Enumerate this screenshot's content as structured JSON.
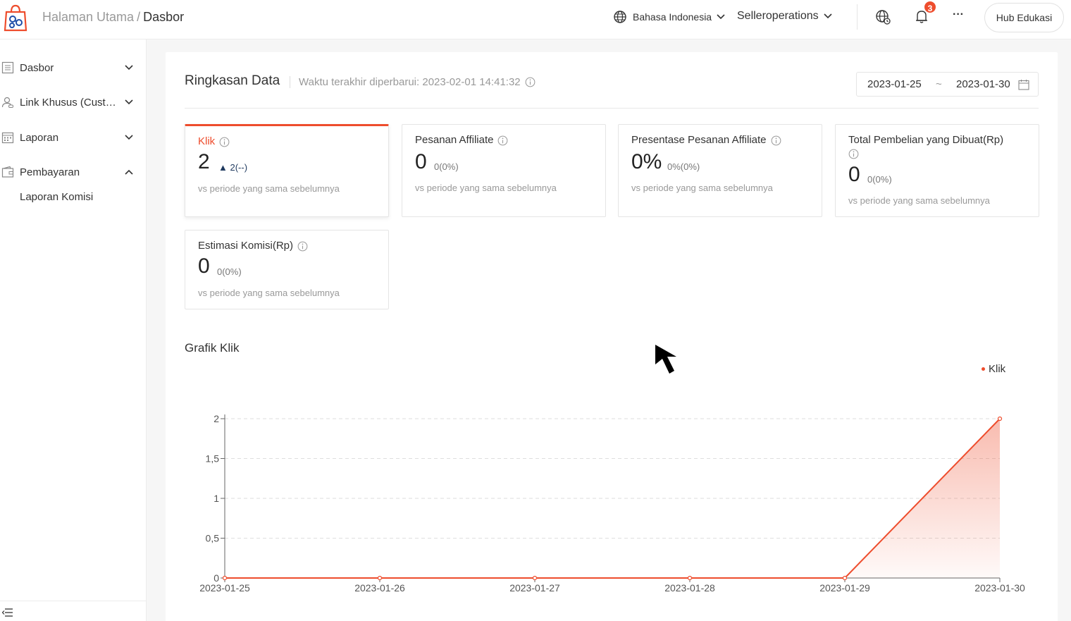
{
  "header": {
    "breadcrumb_home": "Halaman Utama",
    "breadcrumb_sep": "/",
    "breadcrumb_current": "Dasbor",
    "language": "Bahasa Indonesia",
    "shop_name": "Selleroperations",
    "notification_count": "3",
    "more_label": "···",
    "hub_button": "Hub Edukasi"
  },
  "sidebar": {
    "items": [
      {
        "label": "Dasbor",
        "icon": "list-icon"
      },
      {
        "label": "Link Khusus (Custom Link)",
        "icon": "user-link-icon"
      },
      {
        "label": "Laporan",
        "icon": "calendar-grid-icon"
      },
      {
        "label": "Pembayaran",
        "icon": "wallet-icon"
      }
    ],
    "subitems": [
      "Laporan Komisi"
    ]
  },
  "summary": {
    "title": "Ringkasan Data",
    "updated_label": "Waktu terakhir diperbarui: 2023-02-01 14:41:32",
    "date_start": "2023-01-25",
    "date_sep": "~",
    "date_end": "2023-01-30"
  },
  "metrics": [
    {
      "title": "Klik",
      "value": "2",
      "delta": "▲ 2(--)",
      "vs": "vs periode yang sama sebelumnya"
    },
    {
      "title": "Pesanan Affiliate",
      "value": "0",
      "delta": "0(0%)",
      "vs": "vs periode yang sama sebelumnya"
    },
    {
      "title": "Presentase Pesanan Affiliate",
      "value": "0%",
      "delta": "0%(0%)",
      "vs": "vs periode yang sama sebelumnya"
    },
    {
      "title": "Total Pembelian yang Dibuat(Rp)",
      "value": "0",
      "delta": "0(0%)",
      "vs": "vs periode yang sama sebelumnya"
    },
    {
      "title": "Estimasi Komisi(Rp)",
      "value": "0",
      "delta": "0(0%)",
      "vs": "vs periode yang sama sebelumnya"
    }
  ],
  "colors": {
    "accent": "#ee4d2d",
    "fill": "#f6c3b5"
  },
  "chart_section_title": "Grafik Klik",
  "chart_data": {
    "type": "area",
    "title": "Grafik Klik",
    "x": [
      "2023-01-25",
      "2023-01-26",
      "2023-01-27",
      "2023-01-28",
      "2023-01-29",
      "2023-01-30"
    ],
    "series": [
      {
        "name": "Klik",
        "values": [
          0,
          0,
          0,
          0,
          0,
          2
        ]
      }
    ],
    "y_ticks": [
      "0",
      "0,5",
      "1",
      "1,5",
      "2"
    ],
    "ylim": [
      0,
      2
    ],
    "grid": true,
    "legend": "top-right"
  }
}
